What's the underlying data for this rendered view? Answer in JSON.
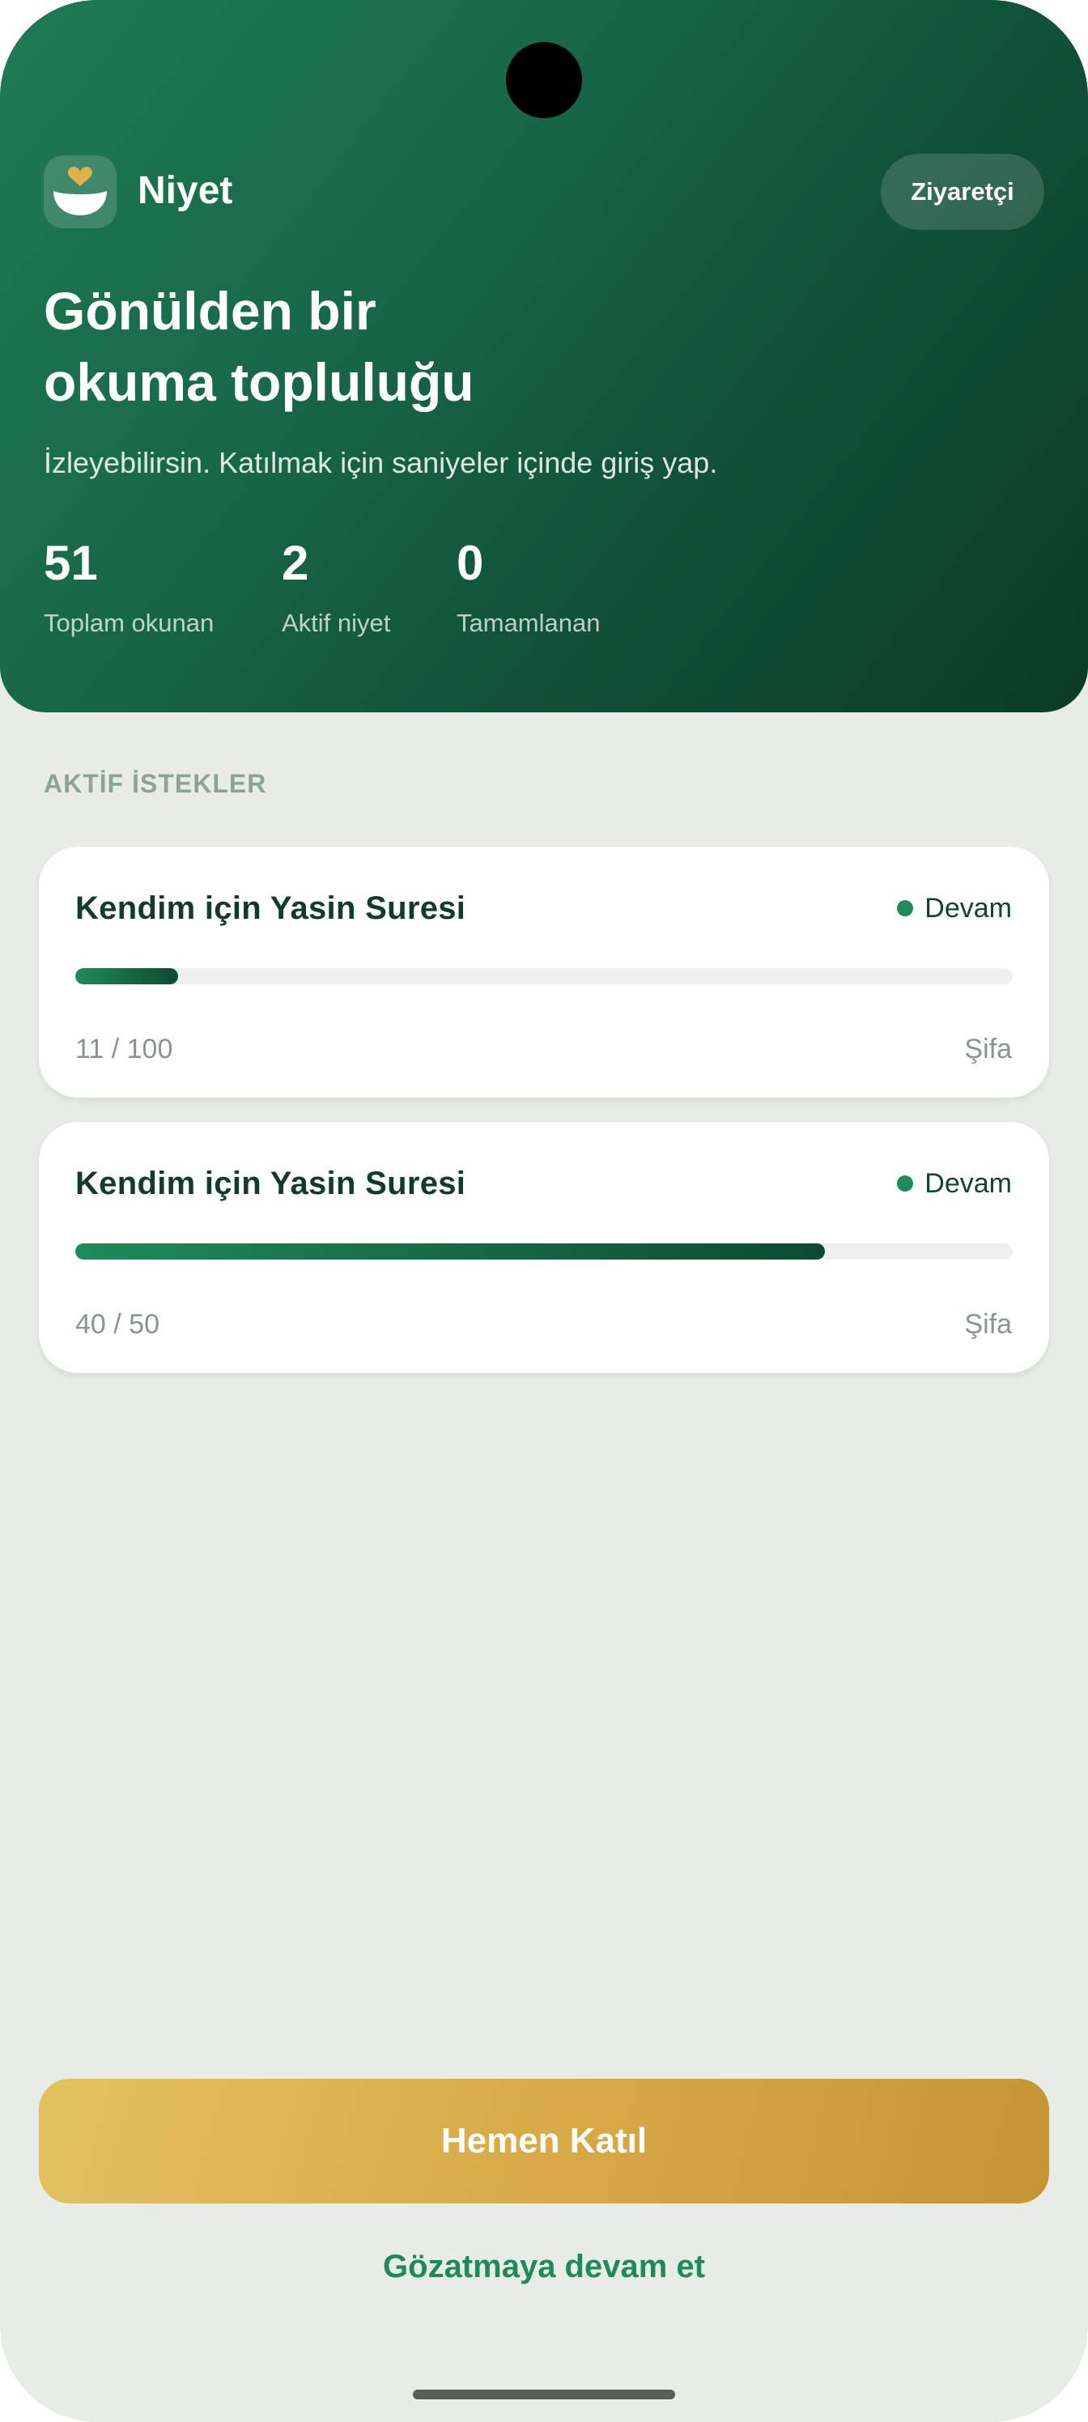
{
  "app": {
    "name": "Niyet",
    "logo_icon": "heart-hands-icon",
    "mode_badge": "Ziyaretçi"
  },
  "hero": {
    "title_line1": "Gönülden bir",
    "title_line2": "okuma topluluğu",
    "subtitle": "İzleyebilirsin. Katılmak için saniyeler içinde giriş yap."
  },
  "stats": [
    {
      "value": "51",
      "label": "Toplam okunan"
    },
    {
      "value": "2",
      "label": "Aktif niyet"
    },
    {
      "value": "0",
      "label": "Tamamlanan"
    }
  ],
  "section": {
    "active_label": "AKTİF İSTEKLER"
  },
  "requests": [
    {
      "title": "Kendim için Yasin Suresi",
      "status": "Devam",
      "count": "11 / 100",
      "progress": 0.11,
      "category": "Şifa"
    },
    {
      "title": "Kendim için Yasin Suresi",
      "status": "Devam",
      "count": "40 / 50",
      "progress": 0.8,
      "category": "Şifa"
    }
  ],
  "actions": {
    "join": "Hemen Katıl",
    "browse": "Gözatmaya devam et"
  },
  "colors": {
    "primary_green": "#1e8a5a",
    "dark_green": "#0e4a33",
    "gold": "#d8aa48",
    "background": "#e8ece7"
  }
}
